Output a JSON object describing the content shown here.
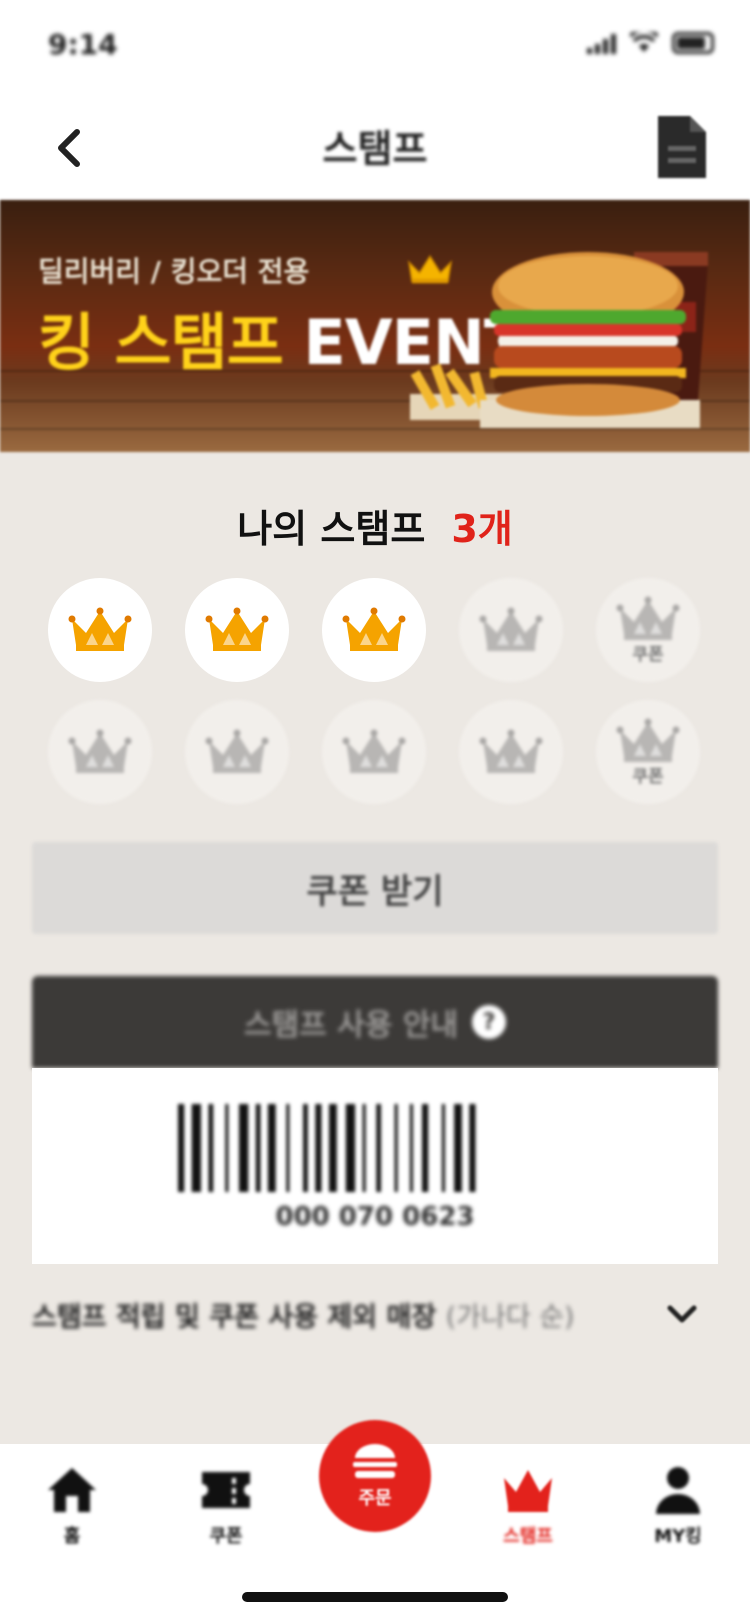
{
  "status_bar": {
    "time": "9:14"
  },
  "header": {
    "title": "스탬프"
  },
  "banner": {
    "subtitle": "딜리버리 / 킹오더 전용",
    "title_highlight": "킹 스탬프",
    "title_suffix": "EVENT"
  },
  "stamps": {
    "label": "나의 스탬프",
    "count": "3개",
    "total": 10,
    "collected": 3,
    "coupon_label": "쿠폰"
  },
  "coupon_button": {
    "label": "쿠폰 받기"
  },
  "guide": {
    "label": "스탬프 사용 안내",
    "help_glyph": "?"
  },
  "barcode": {
    "number": "000 070 0623"
  },
  "store_row": {
    "text": "스탬프 적립 및 쿠폰 사용 제외 매장",
    "note": "(가나다 순)"
  },
  "tabbar": {
    "home": "홈",
    "coupon": "쿠폰",
    "order": "주문",
    "stamp": "스탬프",
    "mypage": "MY킹"
  },
  "colors": {
    "accent_red": "#e3221c",
    "crown_orange": "#f5a300",
    "crown_inactive": "#b8b6b4",
    "background": "#ece8e3"
  }
}
